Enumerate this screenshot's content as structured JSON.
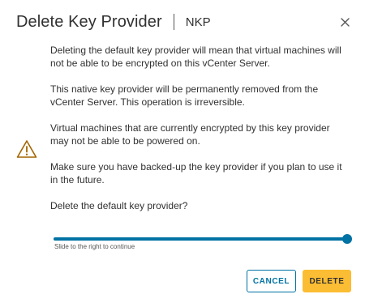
{
  "dialog": {
    "title": "Delete Key Provider",
    "subtitle": "NKP",
    "close_icon": "close-icon",
    "warning_icon": "warning-triangle-icon",
    "paragraphs": [
      "Deleting the default key provider will mean that virtual machines will not be able to be encrypted on this vCenter Server.",
      "This native key provider will be permanently removed from the vCenter Server. This operation is irreversible.",
      "Virtual machines that are currently encrypted by this key provider may not be able to be powered on.",
      "Make sure you have backed-up the key provider if you plan to use it in the future.",
      "Delete the default key provider?"
    ],
    "slider": {
      "hint": "Slide to the right to continue",
      "value_percent": 100
    },
    "buttons": {
      "cancel": "CANCEL",
      "delete": "DELETE"
    }
  },
  "colors": {
    "accent": "#0072a3",
    "warning": "#a36500",
    "delete_button": "#fbbd33",
    "text": "#313131"
  }
}
